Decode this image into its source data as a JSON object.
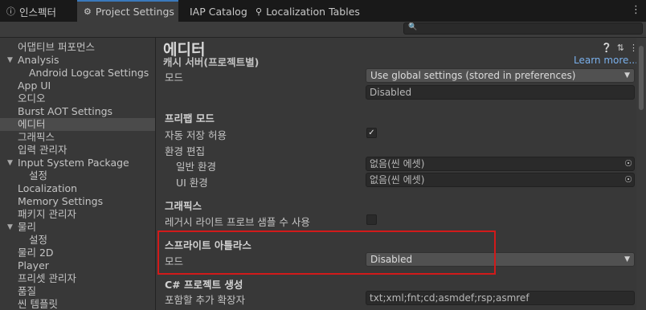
{
  "tabs": [
    {
      "label": "인스펙터",
      "icon": "info-icon"
    },
    {
      "label": "Project Settings",
      "icon": "gear-icon"
    },
    {
      "label": "IAP Catalog"
    },
    {
      "label": "Localization Tables",
      "icon": "localization-tables-icon"
    }
  ],
  "search": {
    "placeholder": ""
  },
  "sidebar": {
    "items": [
      {
        "label": "어댑티브 퍼포먼스"
      },
      {
        "label": "Analysis"
      },
      {
        "label": "Android Logcat Settings"
      },
      {
        "label": "App UI"
      },
      {
        "label": "오디오"
      },
      {
        "label": "Burst AOT Settings"
      },
      {
        "label": "에디터"
      },
      {
        "label": "그래픽스"
      },
      {
        "label": "입력 관리자"
      },
      {
        "label": "Input System Package"
      },
      {
        "label": "설정"
      },
      {
        "label": "Localization"
      },
      {
        "label": "Memory Settings"
      },
      {
        "label": "패키지 관리자"
      },
      {
        "label": "물리"
      },
      {
        "label": "설정"
      },
      {
        "label": "물리 2D"
      },
      {
        "label": "Player"
      },
      {
        "label": "프리셋 관리자"
      },
      {
        "label": "품질"
      },
      {
        "label": "씬 템플릿"
      }
    ]
  },
  "content": {
    "title": "에디터",
    "learn_more": "Learn more...",
    "cache_header": "캐시 서버(프로젝트별)",
    "cache_mode_label": "모드",
    "cache_mode_value": "Use global settings (stored in preferences)",
    "cache_status_value": "Disabled",
    "prefab_header": "프리팹 모드",
    "autosave_label": "자동 저장 허용",
    "autosave_checked": true,
    "env_label": "환경 편집",
    "general_env_label": "일반 환경",
    "general_env_value": "없음(씬 에셋)",
    "ui_env_label": "UI 환경",
    "ui_env_value": "없음(씬 에셋)",
    "graphics_header": "그래픽스",
    "legacy_probe_label": "레거시 라이트 프로브 샘플 수 사용",
    "legacy_probe_checked": false,
    "sprite_atlas_header": "스프라이트 아틀라스",
    "sprite_mode_label": "모드",
    "sprite_mode_value": "Disabled",
    "csharp_header": "C# 프로젝트 생성",
    "extensions_label": "포함할 추가 확장자",
    "extensions_value": "txt;xml;fnt;cd;asmdef;rsp;asmref"
  },
  "colors": {
    "background": "#383838",
    "tabbar": "#191919",
    "accent": "#3a79bb",
    "link": "#7ab0ec",
    "highlight_box": "#d11a1a"
  }
}
